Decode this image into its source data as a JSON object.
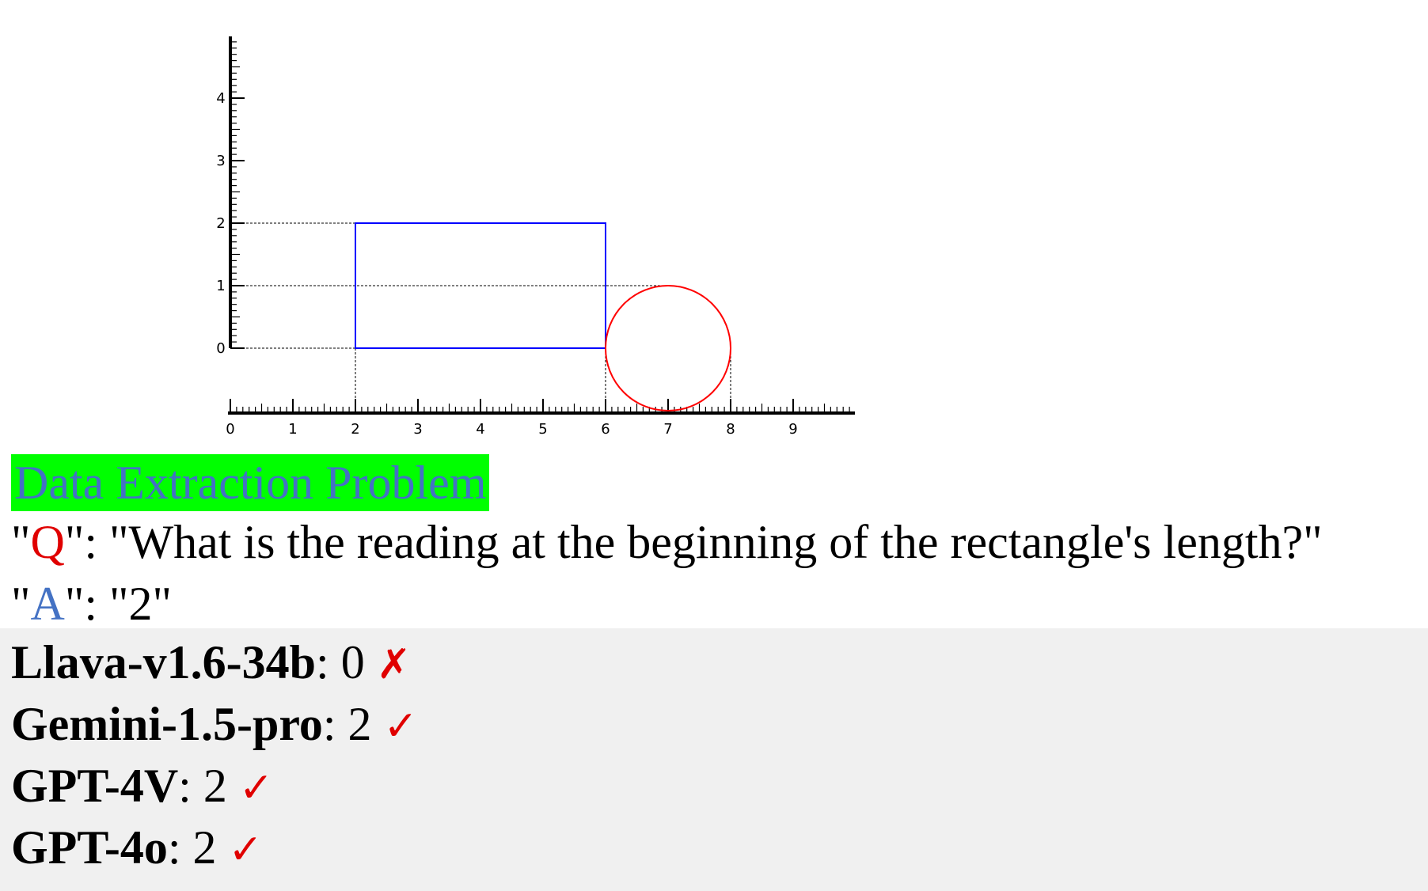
{
  "diagram": {
    "x_ticks": [
      "0",
      "1",
      "2",
      "3",
      "4",
      "5",
      "6",
      "7",
      "8",
      "9"
    ],
    "y_ticks": [
      "0",
      "1",
      "2",
      "3",
      "4"
    ],
    "rectangle": {
      "x1": 2,
      "x2": 6,
      "y1": 0,
      "y2": 2,
      "color": "#0000ff"
    },
    "circle": {
      "cx": 7,
      "cy": 0,
      "r": 1,
      "color": "#ff0000"
    }
  },
  "heading": "Data Extraction Problem",
  "question": {
    "open_quote": "\"",
    "key": "Q",
    "rest": "\": \"What is the reading at the beginning of the rectangle's length?\""
  },
  "answer": {
    "open_quote": "\"",
    "key": "A",
    "rest": "\": \"2\""
  },
  "results": [
    {
      "model": "Llava-v1.6-34b",
      "answer": ": 0 ",
      "mark": "✗"
    },
    {
      "model": "Gemini-1.5-pro",
      "answer": ": 2 ",
      "mark": "✓"
    },
    {
      "model": "GPT-4V",
      "answer": ":  2 ",
      "mark": "✓"
    },
    {
      "model": "GPT-4o",
      "answer": ": 2 ",
      "mark": "✓"
    }
  ],
  "colors": {
    "heading_bg": "#00ff00",
    "heading_text": "#4472c4",
    "q_key": "#e00000",
    "a_key": "#4472c4",
    "results_bg": "#f0f0f0",
    "mark": "#e00000"
  }
}
